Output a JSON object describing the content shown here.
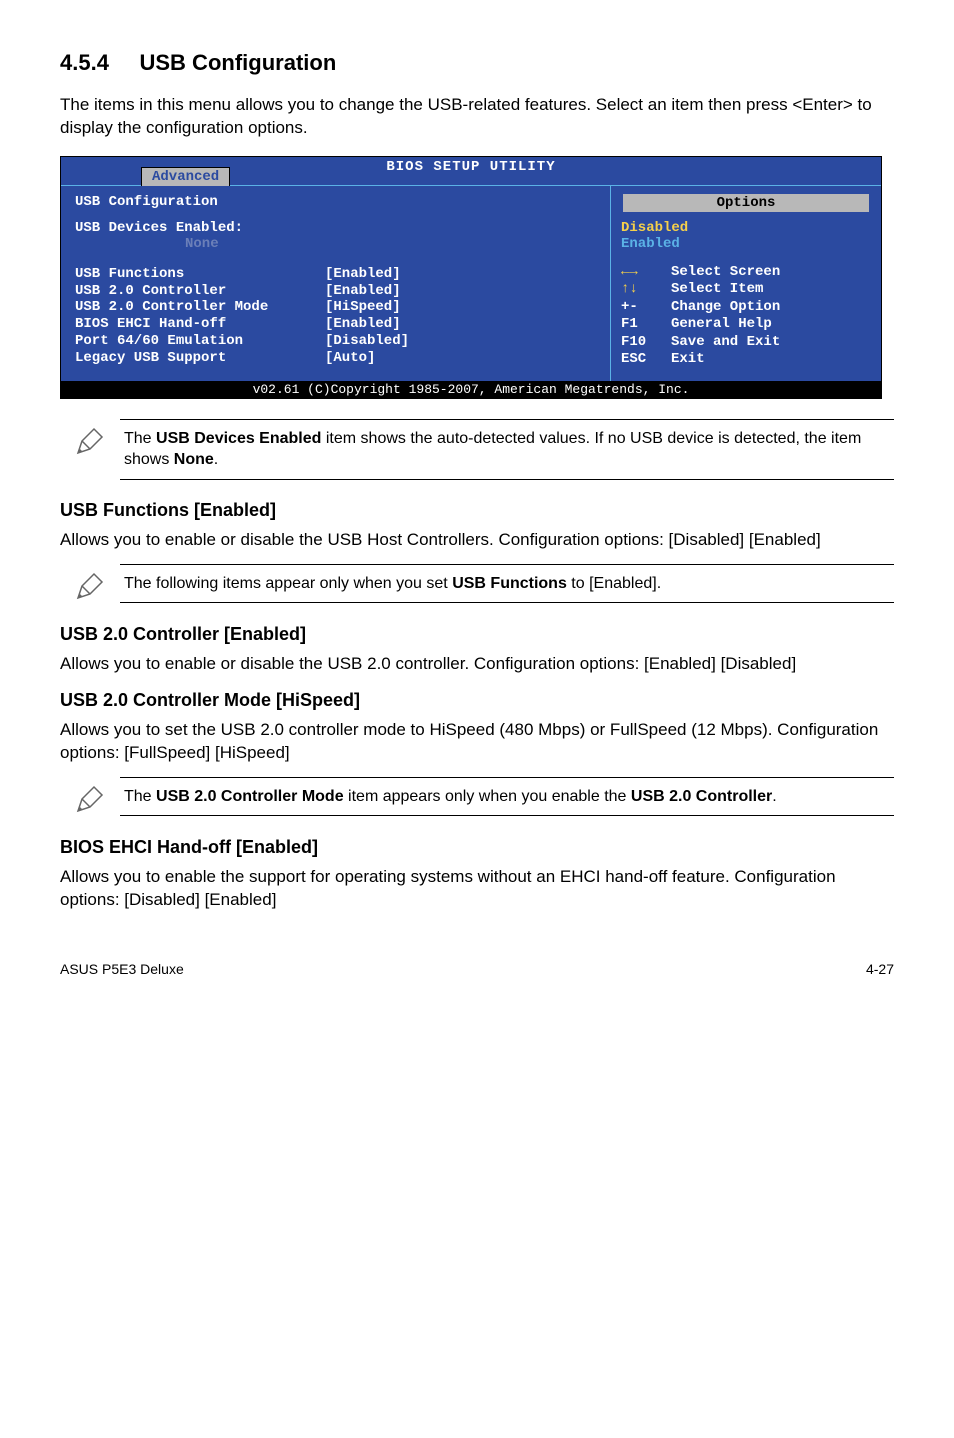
{
  "section": {
    "number": "4.5.4",
    "title": "USB Configuration"
  },
  "intro": "The items in this menu allows you to change the USB-related features. Select an item then press <Enter> to display the configuration options.",
  "bios": {
    "title": "BIOS SETUP UTILITY",
    "tab": "Advanced",
    "heading": "USB Configuration",
    "devices_label": "USB Devices Enabled:",
    "devices_value": "None",
    "rows": [
      {
        "label": "USB Functions",
        "value": "[Enabled]"
      },
      {
        "label": "USB 2.0 Controller",
        "value": "[Enabled]"
      },
      {
        "label": "USB 2.0 Controller Mode",
        "value": "[HiSpeed]"
      },
      {
        "label": "BIOS EHCI Hand-off",
        "value": "[Enabled]"
      },
      {
        "label": "Port 64/60 Emulation",
        "value": "[Disabled]"
      },
      {
        "label": "Legacy USB Support",
        "value": "[Auto]"
      }
    ],
    "right": {
      "options_title": "Options",
      "opt1": "Disabled",
      "opt2": "Enabled",
      "help": [
        {
          "key_icon": "lr",
          "txt": "Select Screen"
        },
        {
          "key_icon": "ud",
          "txt": "Select Item"
        },
        {
          "key": "+-",
          "txt": "Change Option"
        },
        {
          "key": "F1",
          "txt": "General Help"
        },
        {
          "key": "F10",
          "txt": "Save and Exit"
        },
        {
          "key": "ESC",
          "txt": "Exit"
        }
      ]
    },
    "footer": "v02.61 (C)Copyright 1985-2007, American Megatrends, Inc."
  },
  "note1_a": "The ",
  "note1_b": "USB Devices Enabled",
  "note1_c": " item shows the auto-detected values. If no USB device is detected, the item shows ",
  "note1_d": "None",
  "note1_e": ".",
  "h_usb_functions": "USB Functions [Enabled]",
  "p_usb_functions": "Allows you to enable or disable the USB Host Controllers. Configuration options: [Disabled] [Enabled]",
  "note2_a": "The following items appear only when you set ",
  "note2_b": "USB Functions",
  "note2_c": " to [Enabled].",
  "h_usb20": "USB 2.0 Controller [Enabled]",
  "p_usb20": "Allows you to enable or disable the USB 2.0 controller. Configuration options: [Enabled] [Disabled]",
  "h_mode": "USB 2.0 Controller Mode [HiSpeed]",
  "p_mode": "Allows you to set the USB 2.0 controller mode to HiSpeed (480 Mbps) or FullSpeed (12 Mbps). Configuration options: [FullSpeed] [HiSpeed]",
  "note3_a": "The ",
  "note3_b": "USB 2.0 Controller Mode",
  "note3_c": " item appears only when you enable the ",
  "note3_d": "USB 2.0 Controller",
  "note3_e": ".",
  "h_ehci": "BIOS EHCI Hand-off [Enabled]",
  "p_ehci": "Allows you to enable the support for operating systems without an EHCI hand-off feature. Configuration options: [Disabled] [Enabled]",
  "footer": {
    "left": "ASUS P5E3 Deluxe",
    "right": "4-27"
  }
}
